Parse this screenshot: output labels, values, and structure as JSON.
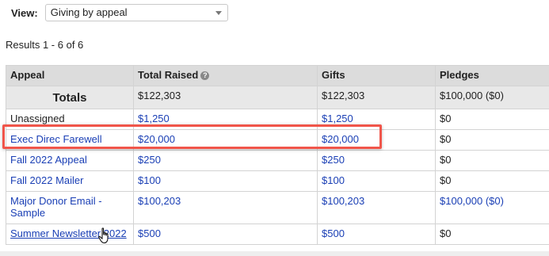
{
  "view": {
    "label": "View:",
    "selected": "Giving by appeal"
  },
  "results_text": "Results 1 - 6 of 6",
  "table": {
    "headers": {
      "appeal": "Appeal",
      "total_raised": "Total Raised",
      "gifts": "Gifts",
      "pledges": "Pledges"
    },
    "totals": {
      "label": "Totals",
      "total_raised": "$122,303",
      "gifts": "$122,303",
      "pledges": "$100,000 ($0)"
    },
    "rows": [
      {
        "appeal": "Unassigned",
        "total_raised": "$1,250",
        "gifts": "$1,250",
        "pledges": "$0"
      },
      {
        "appeal": "Exec Direc Farewell",
        "total_raised": "$20,000",
        "gifts": "$20,000",
        "pledges": "$0"
      },
      {
        "appeal": "Fall 2022 Appeal",
        "total_raised": "$250",
        "gifts": "$250",
        "pledges": "$0"
      },
      {
        "appeal": "Fall 2022 Mailer",
        "total_raised": "$100",
        "gifts": "$100",
        "pledges": "$0"
      },
      {
        "appeal": "Major Donor Email - Sample",
        "total_raised": "$100,203",
        "gifts": "$100,203",
        "pledges": "$100,000 ($0)"
      },
      {
        "appeal": "Summer Newsletter 2022",
        "total_raised": "$500",
        "gifts": "$500",
        "pledges": "$0"
      }
    ]
  },
  "colors": {
    "link": "#1a3fb5",
    "highlight": "#f0554a",
    "header_bg": "#dcdcdc"
  },
  "icons": {
    "help": "question-circle-icon",
    "dropdown": "chevron-down-icon",
    "cursor": "hand-pointer-icon"
  }
}
